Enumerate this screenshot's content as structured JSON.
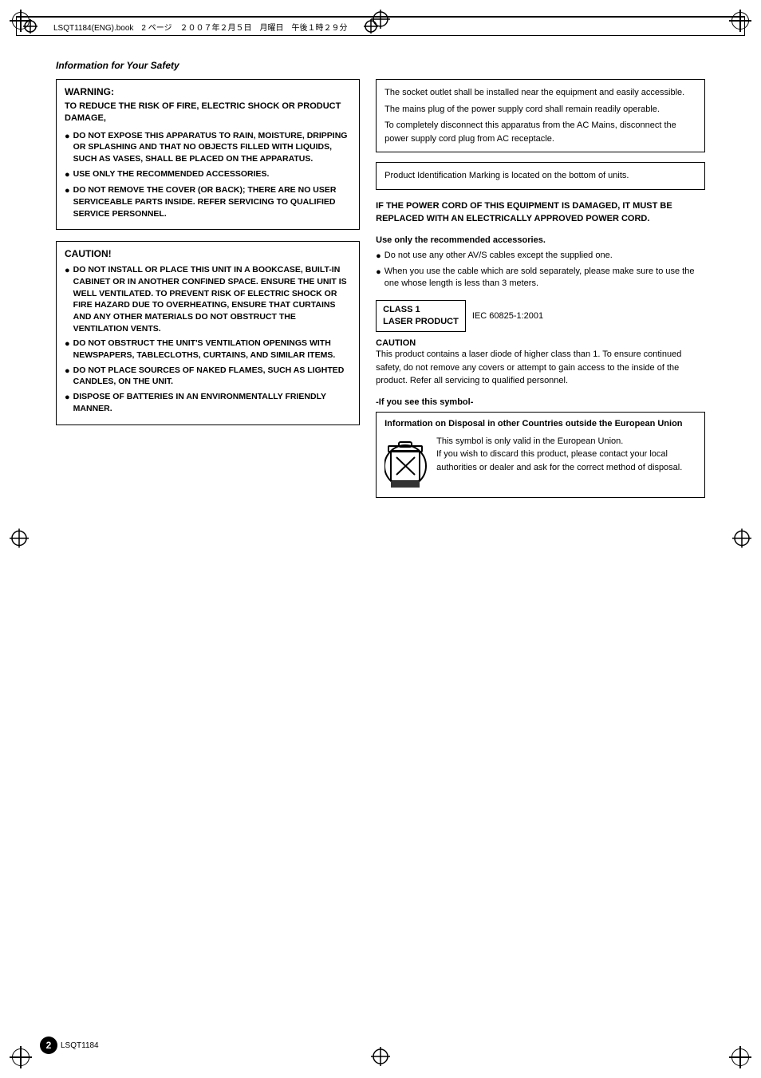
{
  "header": {
    "file_info": "LSQT1184(ENG).book　2 ページ　２００７年２月５日　月曜日　午後１時２９分"
  },
  "section_title": "Information for Your Safety",
  "warning": {
    "title": "WARNING:",
    "subtitle": "TO REDUCE THE RISK OF FIRE, ELECTRIC SHOCK OR PRODUCT DAMAGE,",
    "bullets": [
      "DO NOT EXPOSE THIS APPARATUS TO RAIN, MOISTURE, DRIPPING OR SPLASHING AND THAT NO OBJECTS FILLED WITH LIQUIDS, SUCH AS VASES, SHALL BE PLACED ON THE APPARATUS.",
      "USE ONLY THE RECOMMENDED ACCESSORIES.",
      "DO NOT REMOVE THE COVER (OR BACK); THERE ARE NO USER SERVICEABLE PARTS INSIDE. REFER SERVICING TO QUALIFIED SERVICE PERSONNEL."
    ]
  },
  "caution": {
    "title": "CAUTION!",
    "bullets": [
      "DO NOT INSTALL OR PLACE THIS UNIT IN A BOOKCASE, BUILT-IN CABINET OR IN ANOTHER CONFINED SPACE. ENSURE THE UNIT IS WELL VENTILATED. TO PREVENT RISK OF ELECTRIC SHOCK OR FIRE HAZARD DUE TO OVERHEATING, ENSURE THAT CURTAINS AND ANY OTHER MATERIALS DO NOT OBSTRUCT THE VENTILATION VENTS.",
      "DO NOT OBSTRUCT THE UNIT'S VENTILATION OPENINGS WITH NEWSPAPERS, TABLECLOTHS, CURTAINS, AND SIMILAR ITEMS.",
      "DO NOT PLACE SOURCES OF NAKED FLAMES, SUCH AS LIGHTED CANDLES, ON THE UNIT.",
      "DISPOSE OF BATTERIES IN AN ENVIRONMENTALLY FRIENDLY MANNER."
    ]
  },
  "socket_text": [
    "The socket outlet shall be installed near the equipment and easily accessible.",
    "The mains plug of the power supply cord shall remain readily operable.",
    "To completely disconnect this apparatus from the AC Mains, disconnect the power supply cord plug from AC receptacle."
  ],
  "product_id_text": "Product Identification Marking is located on the bottom of units.",
  "power_cord_text": "IF THE POWER CORD OF THIS EQUIPMENT IS DAMAGED, IT MUST BE REPLACED WITH AN ELECTRICALLY APPROVED POWER CORD.",
  "accessories": {
    "title": "Use only the recommended accessories.",
    "bullets": [
      "Do not use any other AV/S cables except the supplied one.",
      "When you use the cable which are sold separately, please make sure to use the one whose length is less than 3 meters."
    ]
  },
  "laser": {
    "class": "CLASS 1",
    "product": "LASER PRODUCT",
    "iec": "IEC 60825-1:2001",
    "caution_title": "CAUTION",
    "caution_text": "This product contains a laser diode of higher class than 1. To ensure continued safety, do not remove any covers or attempt to gain access to the inside of the product. Refer all servicing to qualified personnel."
  },
  "symbol_section": {
    "intro": "-If you see this symbol-",
    "disposal_title": "Information on Disposal in other Countries outside the European Union",
    "disposal_text": "This symbol is only valid in the European Union.\nIf you wish to discard this product, please contact your local authorities or dealer and ask for the correct method of disposal."
  },
  "footer": {
    "page_number": "2",
    "page_code": "LSQT1184"
  }
}
